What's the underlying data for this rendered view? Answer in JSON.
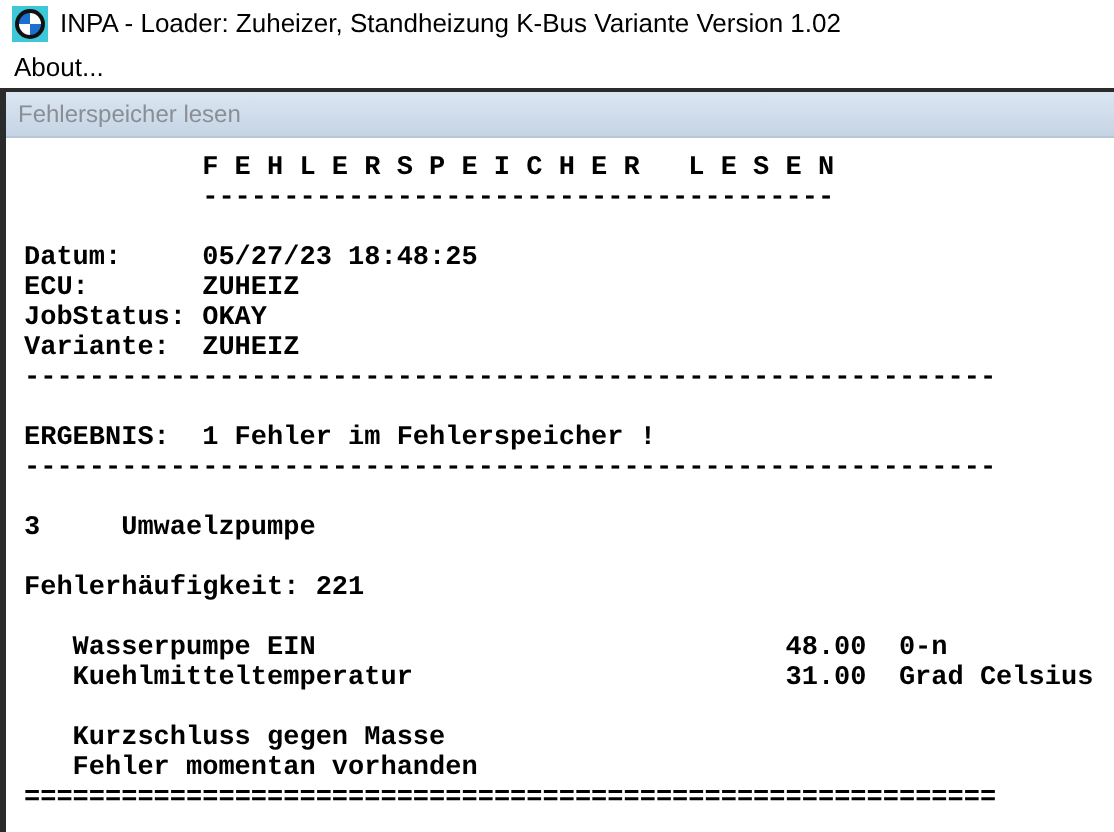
{
  "window": {
    "title": "INPA - Loader:  Zuheizer, Standheizung K-Bus Variante Version 1.02"
  },
  "menu": [
    "About..."
  ],
  "child_window": {
    "title": "Fehlerspeicher lesen"
  },
  "lines": [
    {
      "kind": "heading",
      "text": "F E H L E R S P E I C H E R   L E S E N"
    },
    {
      "kind": "heading",
      "text": "---------------------------------------"
    },
    {
      "kind": "blank"
    },
    {
      "kind": "field",
      "label": "Datum:",
      "value": "05/27/23 18:48:25"
    },
    {
      "kind": "field",
      "label": "ECU:",
      "value": "ZUHEIZ"
    },
    {
      "kind": "field",
      "label": "JobStatus:",
      "value": "OKAY"
    },
    {
      "kind": "field",
      "label": "Variante:",
      "value": "ZUHEIZ"
    },
    {
      "kind": "rule",
      "text": "------------------------------------------------------------"
    },
    {
      "kind": "blank"
    },
    {
      "kind": "field",
      "label": "ERGEBNIS:",
      "value": "1 Fehler im Fehlerspeicher !"
    },
    {
      "kind": "rule",
      "text": "------------------------------------------------------------"
    },
    {
      "kind": "blank"
    },
    {
      "kind": "fault",
      "code": "3",
      "name": "Umwaelzpumpe"
    },
    {
      "kind": "blank"
    },
    {
      "kind": "text",
      "text": "Fehlerhäufigkeit: 221"
    },
    {
      "kind": "blank"
    },
    {
      "kind": "measure",
      "name": "Wasserpumpe EIN",
      "value": "48.00",
      "unit": "0-n"
    },
    {
      "kind": "measure",
      "name": "Kuehlmitteltemperatur",
      "value": "31.00",
      "unit": "Grad Celsius"
    },
    {
      "kind": "blank"
    },
    {
      "kind": "note",
      "text": "Kurzschluss gegen Masse"
    },
    {
      "kind": "note",
      "text": "Fehler momentan vorhanden"
    },
    {
      "kind": "rule",
      "text": "============================================================"
    }
  ]
}
